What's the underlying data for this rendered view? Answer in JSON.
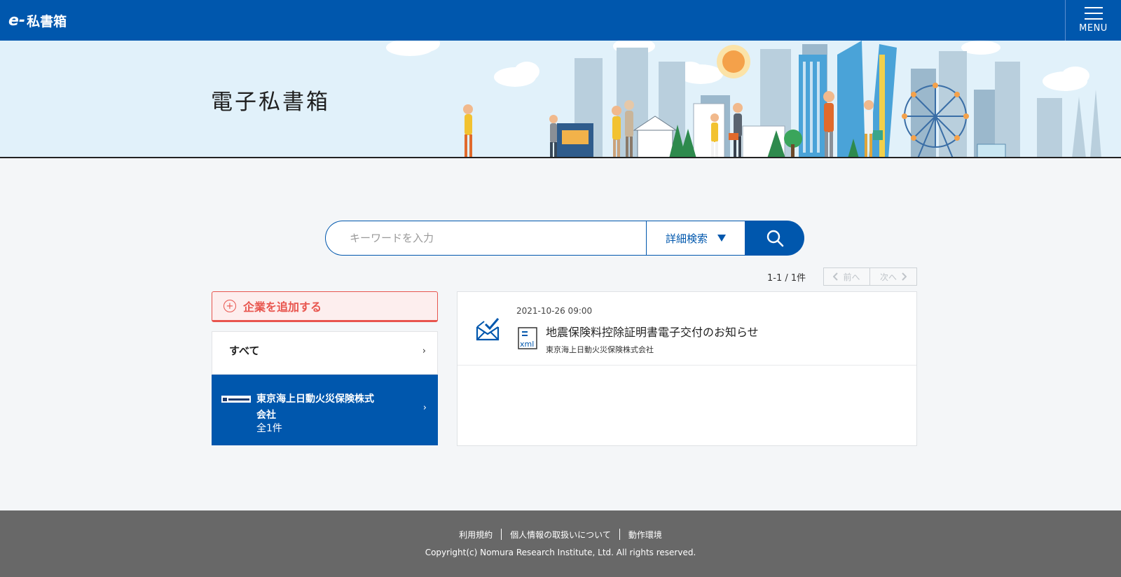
{
  "header": {
    "logo_mark": "e-",
    "logo_text": "私書箱",
    "menu_label": "MENU"
  },
  "hero": {
    "title": "電子私書箱"
  },
  "search": {
    "placeholder": "キーワードを入力",
    "detail_label": "詳細検索"
  },
  "pager": {
    "count": "1-1 / 1件",
    "prev_label": "前へ",
    "next_label": "次へ"
  },
  "sidebar": {
    "add_company_label": "企業を追加する",
    "all_label": "すべて",
    "chevron": "›",
    "company": {
      "name_line1": "東京海上日動火災保険株式",
      "name_line2": "会社",
      "count": "全1件"
    }
  },
  "messages": [
    {
      "date": "2021-10-26 09:00",
      "title": "地震保険料控除証明書電子交付のお知らせ",
      "sender": "東京海上日動火災保険株式会社",
      "file_type": "xml"
    }
  ],
  "footer": {
    "links": [
      "利用規約",
      "個人情報の取扱いについて",
      "動作環境"
    ],
    "copyright": "Copyright(c) Nomura Research Institute, Ltd. All rights reserved."
  },
  "colors": {
    "brand": "#0057ad",
    "accent_red": "#e8554e",
    "footer_bg": "#686868",
    "hero_bg": "#e1f1fa"
  },
  "icons": [
    "hamburger-icon",
    "plus-circle-icon",
    "search-icon",
    "chevron-left-icon",
    "chevron-right-icon",
    "envelope-check-icon",
    "xml-file-icon"
  ]
}
